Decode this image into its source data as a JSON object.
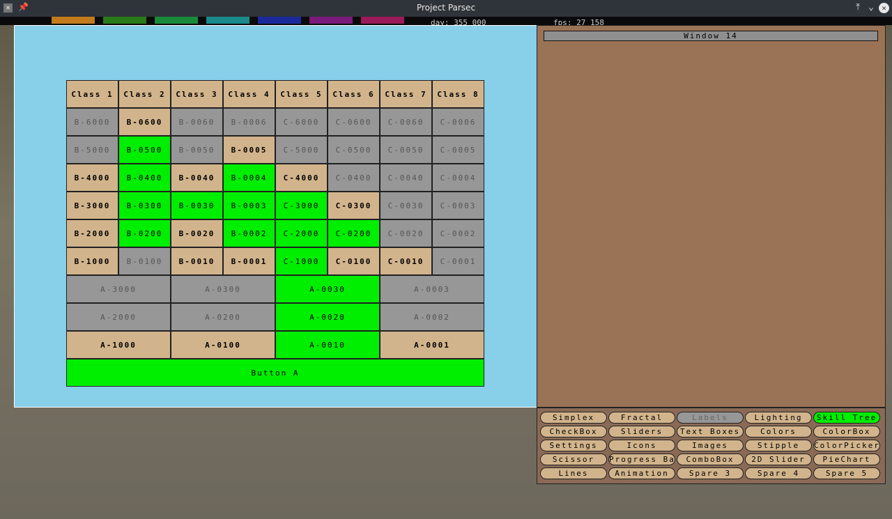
{
  "window": {
    "title": "Project Parsec"
  },
  "hud": {
    "day": "day: 355 000",
    "fps": "fps: 27 158"
  },
  "side_panel": {
    "title": "Window 14"
  },
  "grid": {
    "headers": [
      "Class 1",
      "Class 2",
      "Class 3",
      "Class 4",
      "Class 5",
      "Class 6",
      "Class 7",
      "Class 8"
    ],
    "rows": [
      [
        [
          "B-6000",
          "gray"
        ],
        [
          "B-0600",
          "tan"
        ],
        [
          "B-0060",
          "gray"
        ],
        [
          "B-0006",
          "gray"
        ],
        [
          "C-6000",
          "gray"
        ],
        [
          "C-0600",
          "gray"
        ],
        [
          "C-0060",
          "gray"
        ],
        [
          "C-0006",
          "gray"
        ]
      ],
      [
        [
          "B-5000",
          "gray"
        ],
        [
          "B-0500",
          "green"
        ],
        [
          "B-0050",
          "gray"
        ],
        [
          "B-0005",
          "tan"
        ],
        [
          "C-5000",
          "gray"
        ],
        [
          "C-0500",
          "gray"
        ],
        [
          "C-0050",
          "gray"
        ],
        [
          "C-0005",
          "gray"
        ]
      ],
      [
        [
          "B-4000",
          "tan"
        ],
        [
          "B-0400",
          "green"
        ],
        [
          "B-0040",
          "tan"
        ],
        [
          "B-0004",
          "green"
        ],
        [
          "C-4000",
          "tan"
        ],
        [
          "C-0400",
          "gray"
        ],
        [
          "C-0040",
          "gray"
        ],
        [
          "C-0004",
          "gray"
        ]
      ],
      [
        [
          "B-3000",
          "tan"
        ],
        [
          "B-0300",
          "green"
        ],
        [
          "B-0030",
          "green"
        ],
        [
          "B-0003",
          "green"
        ],
        [
          "C-3000",
          "green"
        ],
        [
          "C-0300",
          "tan"
        ],
        [
          "C-0030",
          "gray"
        ],
        [
          "C-0003",
          "gray"
        ]
      ],
      [
        [
          "B-2000",
          "tan"
        ],
        [
          "B-0200",
          "green"
        ],
        [
          "B-0020",
          "tan"
        ],
        [
          "B-0002",
          "green"
        ],
        [
          "C-2000",
          "green"
        ],
        [
          "C-0200",
          "green"
        ],
        [
          "C-0020",
          "gray"
        ],
        [
          "C-0002",
          "gray"
        ]
      ],
      [
        [
          "B-1000",
          "tan"
        ],
        [
          "B-0100",
          "gray"
        ],
        [
          "B-0010",
          "tan"
        ],
        [
          "B-0001",
          "tan"
        ],
        [
          "C-1000",
          "green"
        ],
        [
          "C-0100",
          "tan"
        ],
        [
          "C-0010",
          "tan"
        ],
        [
          "C-0001",
          "gray"
        ]
      ]
    ],
    "a_rows": [
      [
        [
          "A-3000",
          "gray"
        ],
        [
          "A-0300",
          "gray"
        ],
        [
          "A-0030",
          "green"
        ],
        [
          "A-0003",
          "gray"
        ]
      ],
      [
        [
          "A-2000",
          "gray"
        ],
        [
          "A-0200",
          "gray"
        ],
        [
          "A-0020",
          "green"
        ],
        [
          "A-0002",
          "gray"
        ]
      ],
      [
        [
          "A-1000",
          "tan"
        ],
        [
          "A-0100",
          "tan"
        ],
        [
          "A-0010",
          "green"
        ],
        [
          "A-0001",
          "tan"
        ]
      ]
    ],
    "button_a": "Button A"
  },
  "menu": [
    [
      [
        "Simplex",
        "normal"
      ],
      [
        "Fractal",
        "normal"
      ],
      [
        "Labels",
        "disabled"
      ],
      [
        "Lighting",
        "normal"
      ],
      [
        "Skill Tree",
        "active"
      ]
    ],
    [
      [
        "CheckBox",
        "normal"
      ],
      [
        "Sliders",
        "normal"
      ],
      [
        "Text Boxes",
        "normal"
      ],
      [
        "Colors",
        "normal"
      ],
      [
        "ColorBox",
        "normal"
      ]
    ],
    [
      [
        "Settings",
        "normal"
      ],
      [
        "Icons",
        "normal"
      ],
      [
        "Images",
        "normal"
      ],
      [
        "Stipple",
        "normal"
      ],
      [
        "ColorPicker",
        "normal"
      ]
    ],
    [
      [
        "Scissor",
        "normal"
      ],
      [
        "Progress Bar",
        "normal"
      ],
      [
        "ComboBox",
        "normal"
      ],
      [
        "2D Slider",
        "normal"
      ],
      [
        "PieChart",
        "normal"
      ]
    ],
    [
      [
        "Lines",
        "normal"
      ],
      [
        "Animation",
        "normal"
      ],
      [
        "Spare 3",
        "normal"
      ],
      [
        "Spare 4",
        "normal"
      ],
      [
        "Spare 5",
        "normal"
      ]
    ]
  ]
}
